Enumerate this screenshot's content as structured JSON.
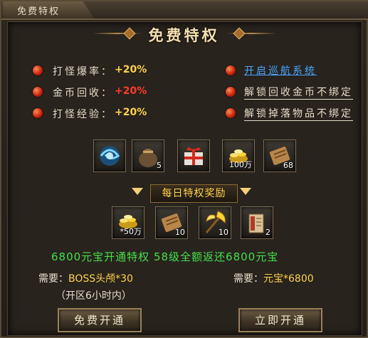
{
  "window": {
    "tab_title": "免费特权"
  },
  "heading": "免费特权",
  "stats": [
    {
      "label": "打怪爆率：",
      "value": "+20%",
      "color": "#ffd34a"
    },
    {
      "label": "金币回收：",
      "value": "+20%",
      "color": "#ff3a2a"
    },
    {
      "label": "打怪经验：",
      "value": "+20%",
      "color": "#ffd34a"
    }
  ],
  "perks": {
    "cruise": "开启巡航系统",
    "recycle": "解锁回收金币不绑定",
    "drop": "解锁掉落物品不绑定"
  },
  "privilege_items": [
    {
      "icon": "blue-orb-icon",
      "count": ""
    },
    {
      "icon": "coin-sack-icon",
      "count": "5"
    },
    {
      "icon": "gift-box-icon",
      "count": ""
    },
    {
      "icon": "gold-pile-icon",
      "count": "100万"
    },
    {
      "icon": "scroll-icon",
      "count": "68"
    }
  ],
  "daily_title": "每日特权奖励",
  "daily_items": [
    {
      "icon": "gold-pile-icon",
      "count": "*50万"
    },
    {
      "icon": "scroll-icon",
      "count": "10"
    },
    {
      "icon": "golden-axe-icon",
      "count": "10"
    },
    {
      "icon": "book-icon",
      "count": "2"
    }
  ],
  "info_line": "6800元宝开通特权  58级全额返还6800元宝",
  "left_need": {
    "prefix": "需要：",
    "value": "BOSS头颅*30"
  },
  "right_need": {
    "prefix": "需要：",
    "value": "元宝*6800"
  },
  "server_note": "（开区6小时内）",
  "buttons": {
    "free": "免费开通",
    "buy": "立即开通"
  }
}
